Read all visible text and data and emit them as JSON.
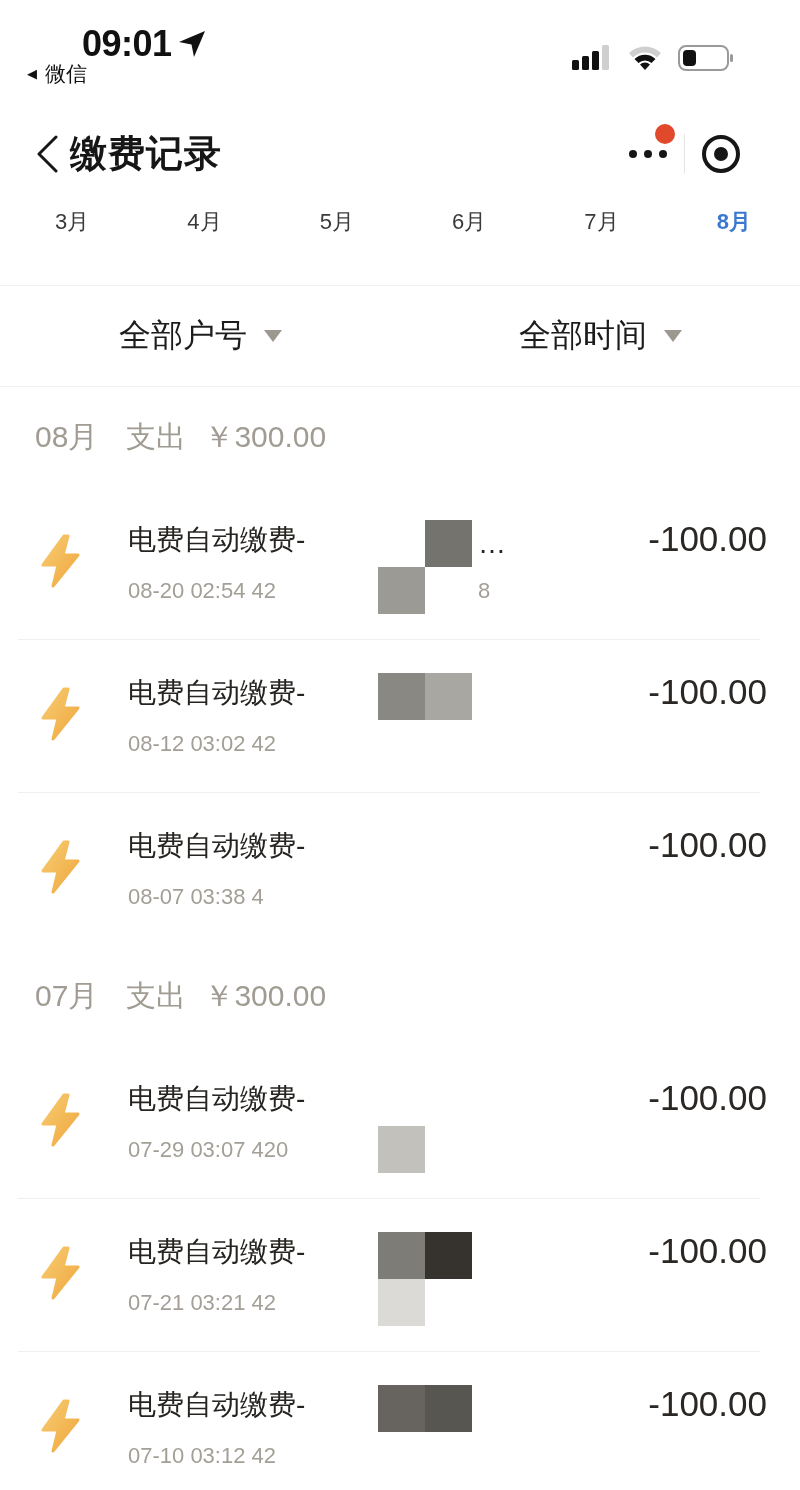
{
  "status_bar": {
    "time": "09:01",
    "back_glyph": "◀",
    "back_label": "微信"
  },
  "nav_bar": {
    "title": "缴费记录",
    "more_badge": true
  },
  "month_tabs": [
    {
      "label": "3月",
      "selected": false
    },
    {
      "label": "4月",
      "selected": false
    },
    {
      "label": "5月",
      "selected": false
    },
    {
      "label": "6月",
      "selected": false
    },
    {
      "label": "7月",
      "selected": false
    },
    {
      "label": "8月",
      "selected": true
    }
  ],
  "filters": [
    {
      "label": "全部户号"
    },
    {
      "label": "全部时间"
    }
  ],
  "sections": [
    {
      "month": "08月",
      "type_label": "支出",
      "total": "￥300.00",
      "records": [
        {
          "title": "电费自动缴费-",
          "detail": "08-20 02:54 42",
          "amount": "-100.00",
          "title_mosaic": [
            {
              "color": "#75736e"
            }
          ],
          "detail_mosaic": [
            {
              "color": "#9c9a95"
            }
          ],
          "title_tail": "…",
          "detail_tail": "8"
        },
        {
          "title": "电费自动缴费-",
          "detail": "08-12 03:02 42",
          "amount": "-100.00",
          "title_mosaic": [
            {
              "color": "#8a8883"
            },
            {
              "color": "#a9a7a2"
            }
          ]
        },
        {
          "title": "电费自动缴费-",
          "detail": "08-07 03:38 4",
          "amount": "-100.00"
        }
      ]
    },
    {
      "month": "07月",
      "type_label": "支出",
      "total": "￥300.00",
      "records": [
        {
          "title": "电费自动缴费-",
          "detail": "07-29 03:07 420",
          "amount": "-100.00",
          "detail_mosaic": [
            {
              "color": "#c3c1bc"
            }
          ]
        },
        {
          "title": "电费自动缴费-",
          "detail": "07-21 03:21 42",
          "amount": "-100.00",
          "title_mosaic": [
            {
              "color": "#7e7c77"
            },
            {
              "color": "#36322e"
            }
          ],
          "detail_mosaic": [
            {
              "color": "#dcdad6"
            }
          ]
        },
        {
          "title": "电费自动缴费-",
          "detail": "07-10 03:12 42",
          "amount": "-100.00",
          "title_mosaic": [
            {
              "color": "#67645f"
            },
            {
              "color": "#585651"
            }
          ]
        }
      ]
    }
  ]
}
